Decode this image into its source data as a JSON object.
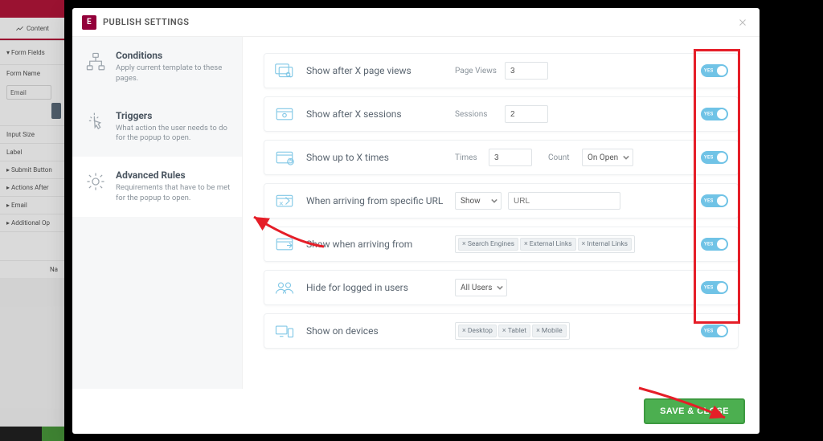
{
  "modal": {
    "title": "PUBLISH SETTINGS",
    "logo_letter": "E",
    "save_button": "SAVE & CLOSE"
  },
  "sidebar_tabs": {
    "conditions": {
      "title": "Conditions",
      "desc": "Apply current template to these pages."
    },
    "triggers": {
      "title": "Triggers",
      "desc": "What action the user needs to do for the popup to open."
    },
    "advanced": {
      "title": "Advanced Rules",
      "desc": "Requirements that have to be met for the popup to open."
    }
  },
  "rules": {
    "page_views": {
      "label": "Show after X page views",
      "field_label": "Page Views",
      "value": "3"
    },
    "sessions": {
      "label": "Show after X sessions",
      "field_label": "Sessions",
      "value": "2"
    },
    "up_to": {
      "label": "Show up to X times",
      "times_label": "Times",
      "times_value": "3",
      "count_label": "Count",
      "count_select": "On Open"
    },
    "from_url": {
      "label": "When arriving from specific URL",
      "select": "Show",
      "placeholder": "URL"
    },
    "arriving_from": {
      "label": "Show when arriving from",
      "tags": [
        "Search Engines",
        "External Links",
        "Internal Links"
      ]
    },
    "hide_logged": {
      "label": "Hide for logged in users",
      "select": "All Users"
    },
    "devices": {
      "label": "Show on devices",
      "tags": [
        "Desktop",
        "Tablet",
        "Mobile"
      ]
    }
  },
  "toggle_text": "YES",
  "bg_editor": {
    "tab": "Content",
    "section": "Form Fields",
    "form_name_label": "Form Name",
    "email_value": "Email",
    "input_size": "Input Size",
    "label": "Label",
    "rows": [
      "Submit Button",
      "Actions After",
      "Email",
      "Additional Op"
    ],
    "placeholder_row": "Na"
  }
}
